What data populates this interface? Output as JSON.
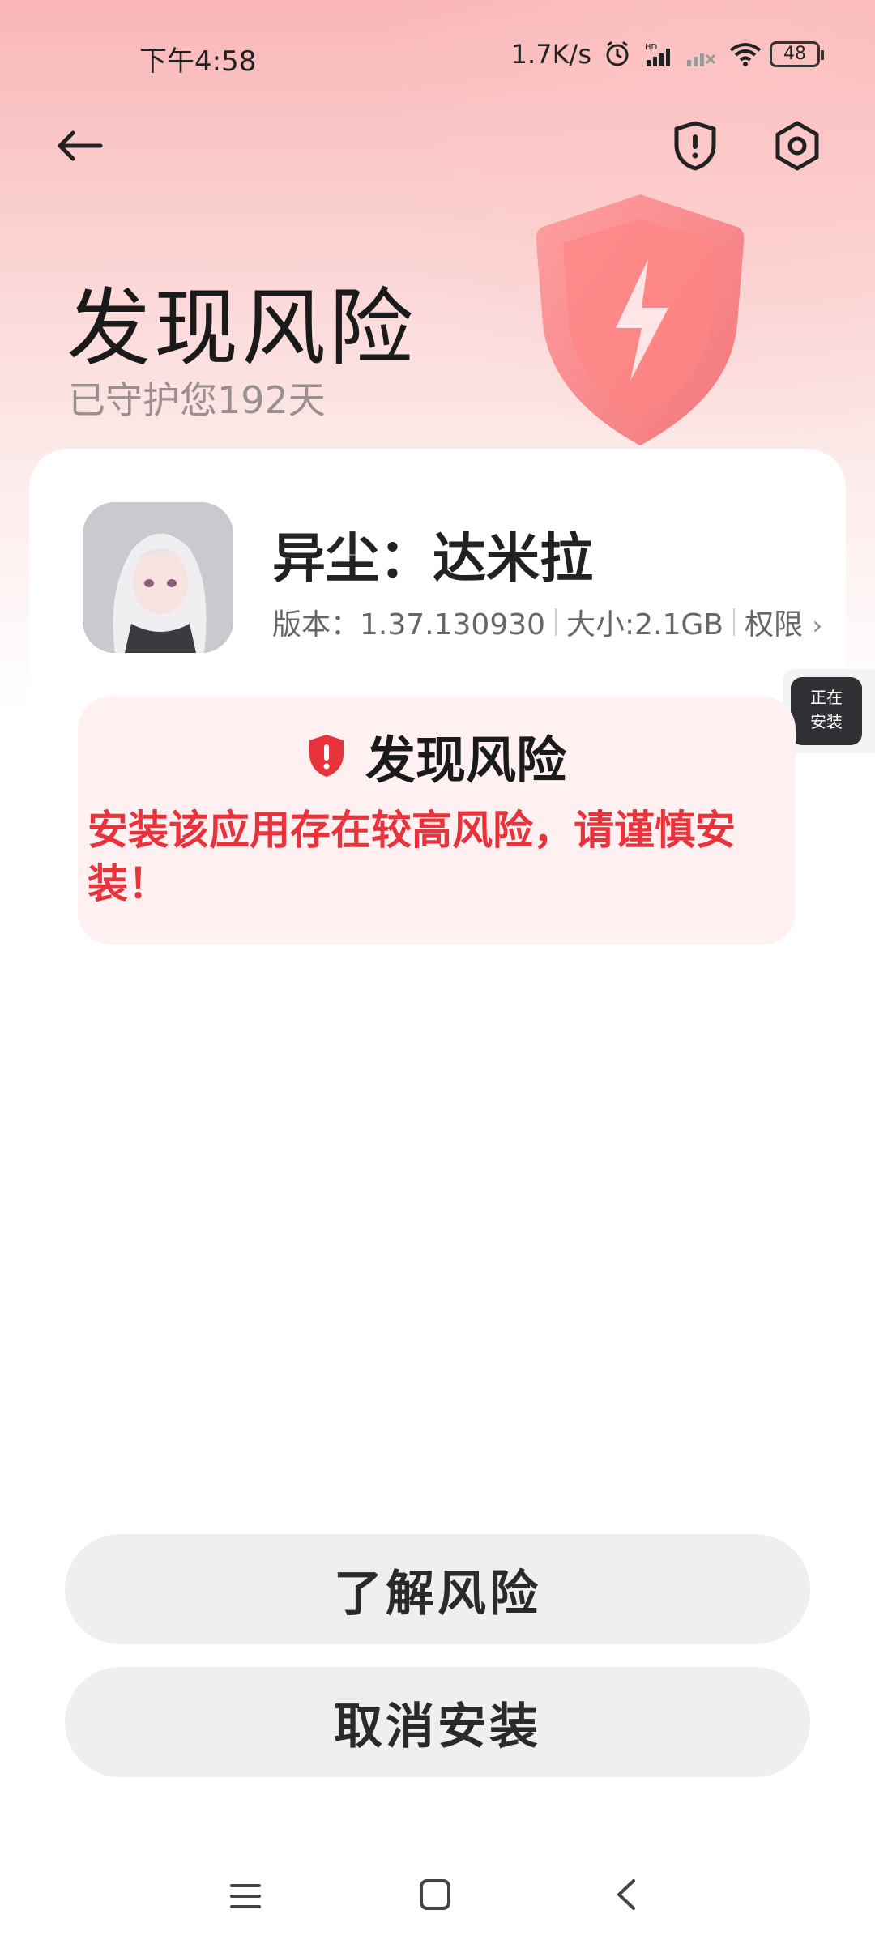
{
  "status_bar": {
    "time": "下午4:58",
    "network_speed": "1.7K/s",
    "battery": "48",
    "icons": [
      "alarm-icon",
      "hd-signal-icon",
      "signal-icon",
      "wifi-icon",
      "battery-icon"
    ]
  },
  "header": {
    "title": "发现风险",
    "subtitle": "已守护您192天",
    "icons": [
      "back-arrow-icon",
      "shield-alert-icon",
      "settings-icon"
    ]
  },
  "app": {
    "name": "异尘：达米拉",
    "version": "版本：1.37.130930",
    "size": "大小:2.1GB",
    "permissions": "权限",
    "icon": "app-icon"
  },
  "installing_badge": {
    "line1": "正在",
    "line2": "安装"
  },
  "risk": {
    "title": "发现风险",
    "message": "安装该应用存在较高风险，请谨慎安装！",
    "icon": "shield-alert-icon",
    "accent_color": "#e8333d"
  },
  "buttons": {
    "learn_risk": "了解风险",
    "cancel_install": "取消安装"
  },
  "nav_bar": {
    "icons": [
      "menu-icon",
      "home-icon",
      "back-icon"
    ]
  },
  "colors": {
    "hero_gradient_top": "#f9b6b6",
    "button_bg": "#efefef",
    "risk_box_bg": "#fff0f1"
  }
}
